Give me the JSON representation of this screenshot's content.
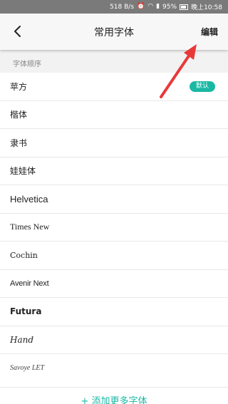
{
  "status_bar": {
    "network_speed": "518 B/s",
    "battery_percent": "95%",
    "time": "晚上10:58",
    "icons": [
      "alarm-icon",
      "wifi-icon",
      "signal-icon",
      "battery-icon"
    ]
  },
  "header": {
    "title": "常用字体",
    "edit_label": "编辑",
    "back_icon": "chevron-left-icon"
  },
  "section": {
    "label": "字体顺序"
  },
  "fonts": [
    {
      "name": "苹方",
      "badge": "默认"
    },
    {
      "name": "楷体"
    },
    {
      "name": "隶书"
    },
    {
      "name": "娃娃体"
    },
    {
      "name": "Helvetica"
    },
    {
      "name": "Times New"
    },
    {
      "name": "Cochin"
    },
    {
      "name": "Avenir Next"
    },
    {
      "name": "Futura"
    },
    {
      "name": "Hand"
    },
    {
      "name": "Savoye LET"
    }
  ],
  "footer": {
    "add_more_label": "+ 添加更多字体"
  },
  "colors": {
    "accent": "#19b8a3",
    "annotation": "#e8393a",
    "status_bar": "#7a7a7a"
  }
}
